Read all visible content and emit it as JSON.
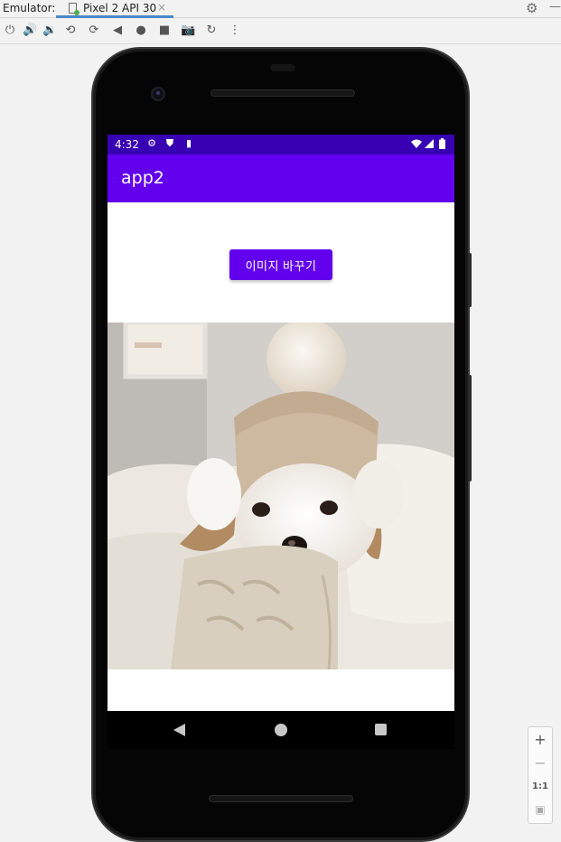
{
  "ide": {
    "panel_label": "Emulator:",
    "device_tab": "Pixel 2 API 30",
    "toolbar_icons": [
      "power-icon",
      "volume-up-icon",
      "volume-down-icon",
      "rotate-left-icon",
      "rotate-right-icon",
      "back-icon",
      "home-icon",
      "overview-icon",
      "screenshot-icon",
      "snapshot-icon",
      "more-icon"
    ]
  },
  "status_bar": {
    "time": "4:32",
    "color": "#3700b3"
  },
  "app_bar": {
    "title": "app2",
    "color": "#6200ee"
  },
  "main": {
    "button_label": "이미지 바꾸기",
    "image_subject": "puppy-photo"
  },
  "zoom_panel": {
    "one_to_one_label": "1:1"
  }
}
